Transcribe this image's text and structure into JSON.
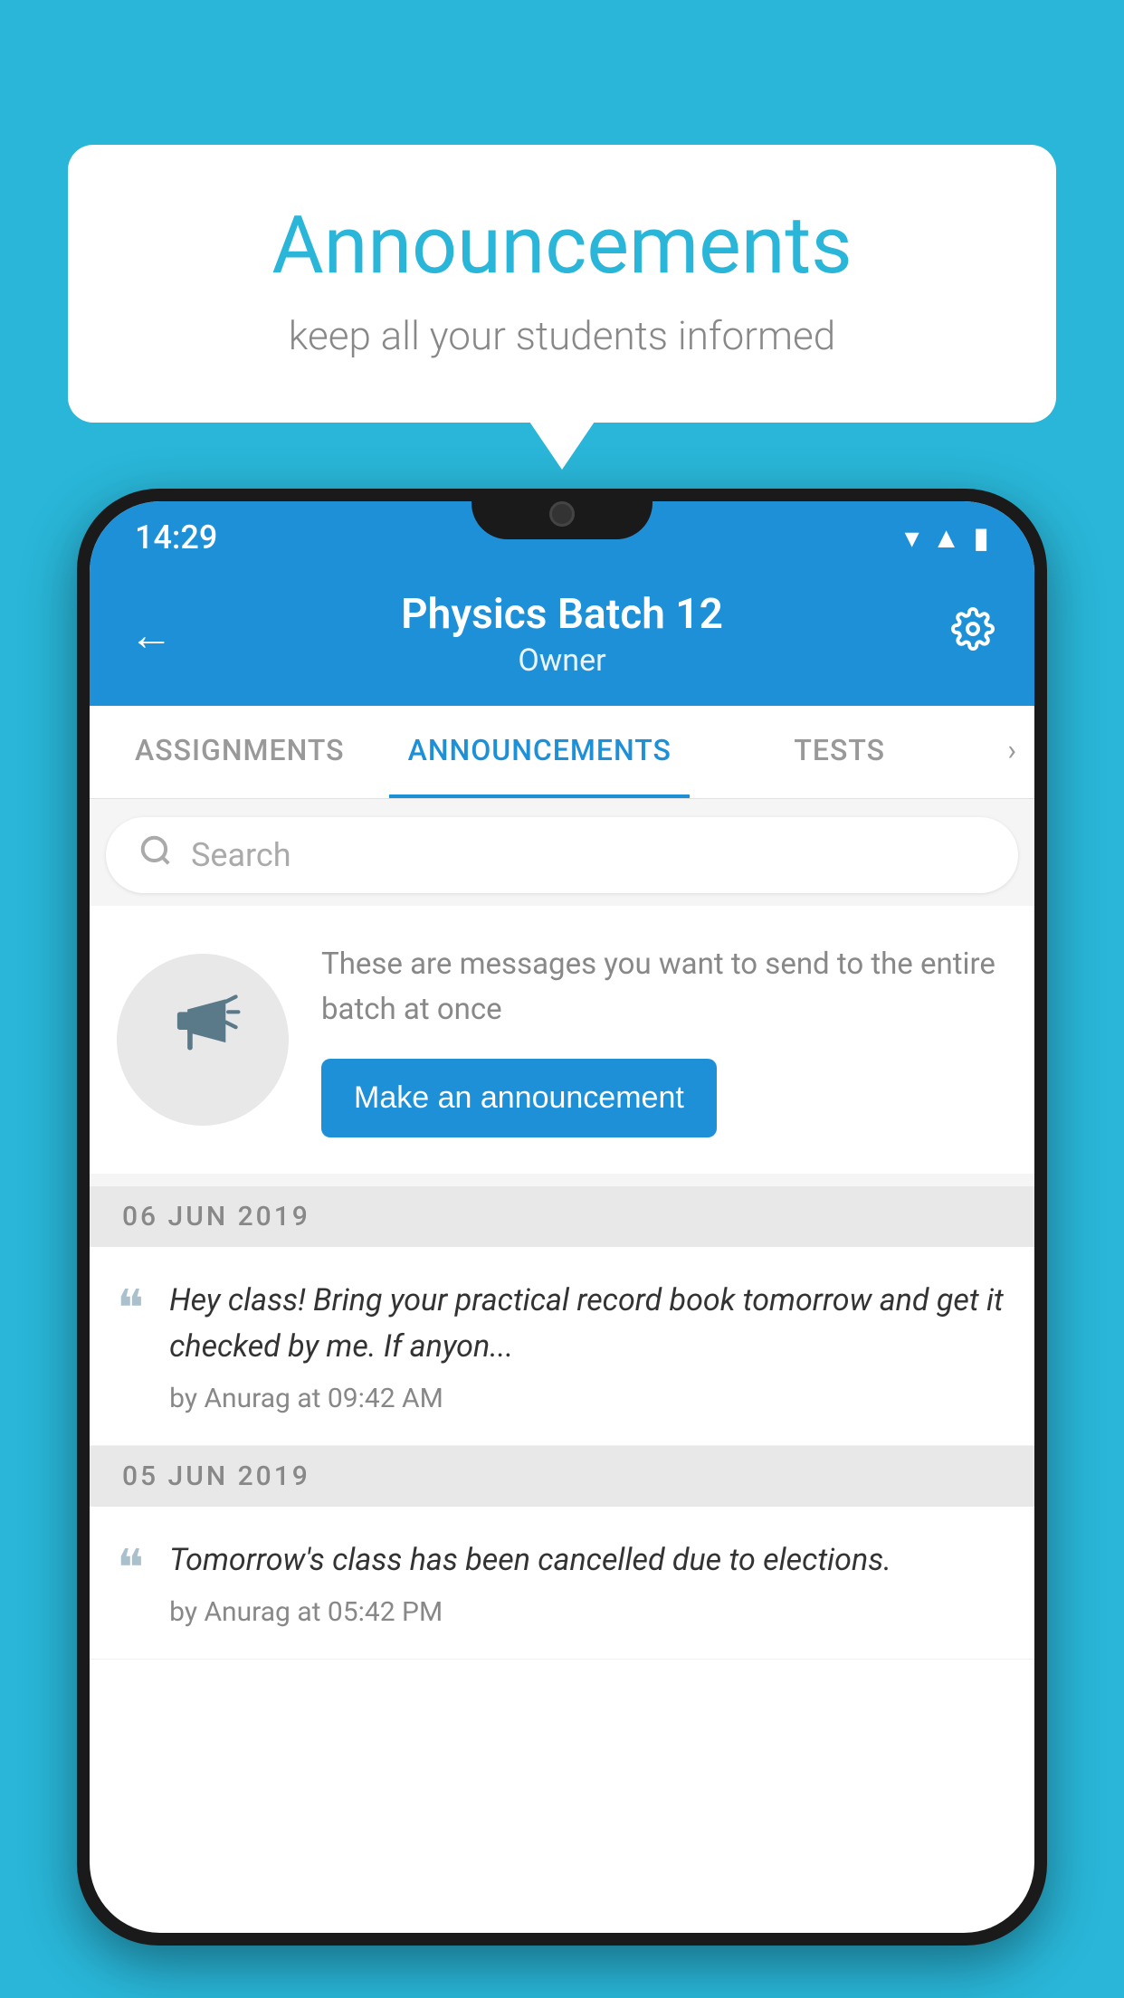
{
  "background_color": "#29b6d8",
  "bubble": {
    "title": "Announcements",
    "subtitle": "keep all your students informed"
  },
  "phone": {
    "status_bar": {
      "time": "14:29"
    },
    "app_bar": {
      "title": "Physics Batch 12",
      "subtitle": "Owner",
      "back_label": "←",
      "settings_label": "⚙"
    },
    "tabs": [
      {
        "label": "ASSIGNMENTS",
        "active": false
      },
      {
        "label": "ANNOUNCEMENTS",
        "active": true
      },
      {
        "label": "TESTS",
        "active": false
      }
    ],
    "search": {
      "placeholder": "Search"
    },
    "empty_state": {
      "description": "These are messages you want to send to the entire batch at once",
      "cta_label": "Make an announcement"
    },
    "announcements": [
      {
        "date": "06  JUN  2019",
        "text": "Hey class! Bring your practical record book tomorrow and get it checked by me. If anyon...",
        "author": "by Anurag at 09:42 AM"
      },
      {
        "date": "05  JUN  2019",
        "text": "Tomorrow's class has been cancelled due to elections.",
        "author": "by Anurag at 05:42 PM"
      }
    ]
  }
}
